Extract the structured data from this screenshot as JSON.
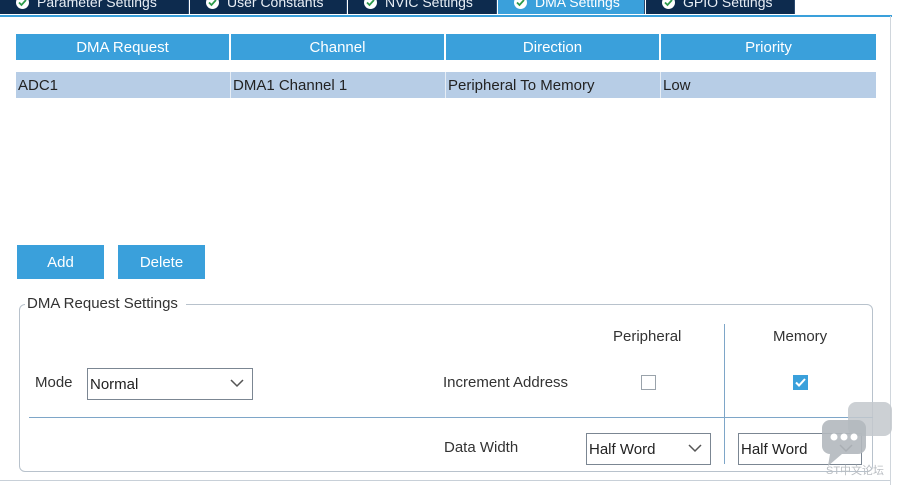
{
  "tabs": [
    {
      "label": "Parameter Settings",
      "active": false
    },
    {
      "label": "User Constants",
      "active": false
    },
    {
      "label": "NVIC Settings",
      "active": false
    },
    {
      "label": "DMA Settings",
      "active": true
    },
    {
      "label": "GPIO Settings",
      "active": false
    }
  ],
  "table": {
    "headers": [
      "DMA Request",
      "Channel",
      "Direction",
      "Priority"
    ],
    "rows": [
      {
        "request": "ADC1",
        "channel": "DMA1 Channel 1",
        "direction": "Peripheral To Memory",
        "priority": "Low"
      }
    ]
  },
  "buttons": {
    "add": "Add",
    "delete": "Delete"
  },
  "settings": {
    "legend": "DMA Request Settings",
    "mode_label": "Mode",
    "mode_value": "Normal",
    "peripheral_header": "Peripheral",
    "memory_header": "Memory",
    "increment_label": "Increment Address",
    "increment_peripheral_checked": false,
    "increment_memory_checked": true,
    "data_width_label": "Data Width",
    "data_width_peripheral": "Half Word",
    "data_width_memory": "Half Word"
  },
  "watermark": {
    "text": "ST中文论坛"
  },
  "colors": {
    "accent": "#3aa0db",
    "tab_dark": "#0d2b4e",
    "row_selected": "#b7cde6"
  }
}
